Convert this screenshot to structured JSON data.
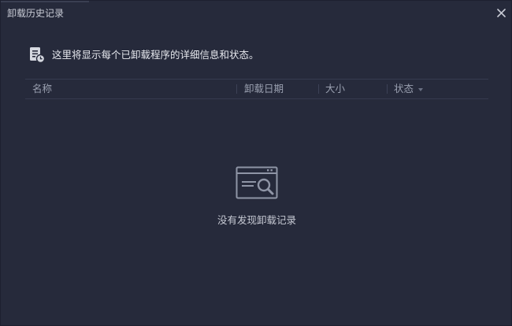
{
  "window": {
    "title": "卸载历史记录",
    "close_icon": "close-icon"
  },
  "info": {
    "icon": "document-clock-icon",
    "text": "这里将显示每个已卸载程序的详细信息和状态。"
  },
  "table": {
    "columns": [
      {
        "label": "名称"
      },
      {
        "label": "卸载日期"
      },
      {
        "label": "大小"
      },
      {
        "label": "状态",
        "sort_icon": "caret-down-icon"
      }
    ]
  },
  "empty_state": {
    "icon": "browser-search-icon",
    "text": "没有发现卸载记录"
  },
  "colors": {
    "background": "#262a3b",
    "text_primary": "#e6e8ee",
    "text_muted": "#9aa0b0",
    "divider": "#363b4f"
  }
}
